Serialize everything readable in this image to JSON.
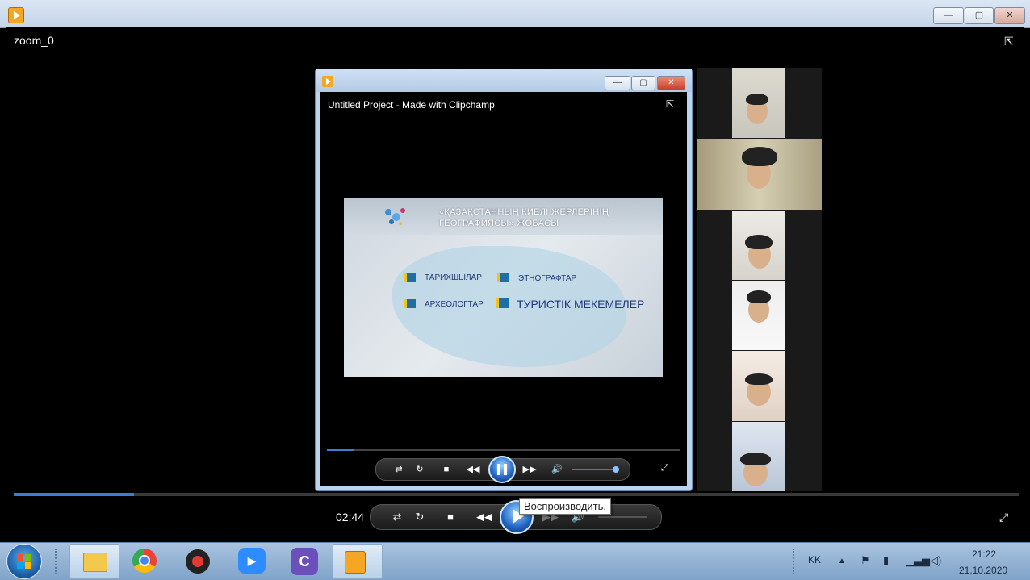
{
  "outer_window": {
    "title": "zoom_0",
    "time": "02:44",
    "seek_percent": 12,
    "tooltip": "Воспроизводить.",
    "buttons": {
      "minimize": "—",
      "maximize": "▢",
      "close": "✕"
    }
  },
  "inner_window": {
    "title": "Untitled Project - Made with Clipchamp",
    "seek_percent": 7.5,
    "buttons": {
      "minimize": "—",
      "maximize": "▢",
      "close": "✕"
    },
    "video": {
      "heading": "«ҚАЗАҚСТАННЫҢ КИЕЛІ ЖЕРЛЕРІНІҢ ГЕОГРАФИЯСЫ» ЖОБАСЫ",
      "label_historians": "ТАРИХШЫЛАР",
      "label_ethnographers": "ЭТНОГРАФТАР",
      "label_archaeologists": "АРХЕОЛОГТАР",
      "label_tourism": "ТУРИСТІК МЕКЕМЕЛЕР"
    }
  },
  "controls": {
    "repeat": "⇄",
    "loop": "↻",
    "stop": "■",
    "rewind": "◀◀",
    "forward": "▶▶",
    "volume": "🔊"
  },
  "taskbar": {
    "language": "KK",
    "time": "21:22",
    "date": "21.10.2020",
    "apps": [
      "file-explorer",
      "chrome",
      "recorder",
      "zoom",
      "clipchamp",
      "media-player"
    ],
    "zoom_label": "▶",
    "clipchamp_label": "C"
  },
  "colors": {
    "accent": "#3e7bd1",
    "taskbar": "#a9c3df",
    "titlebar": "#dbe6f3"
  }
}
